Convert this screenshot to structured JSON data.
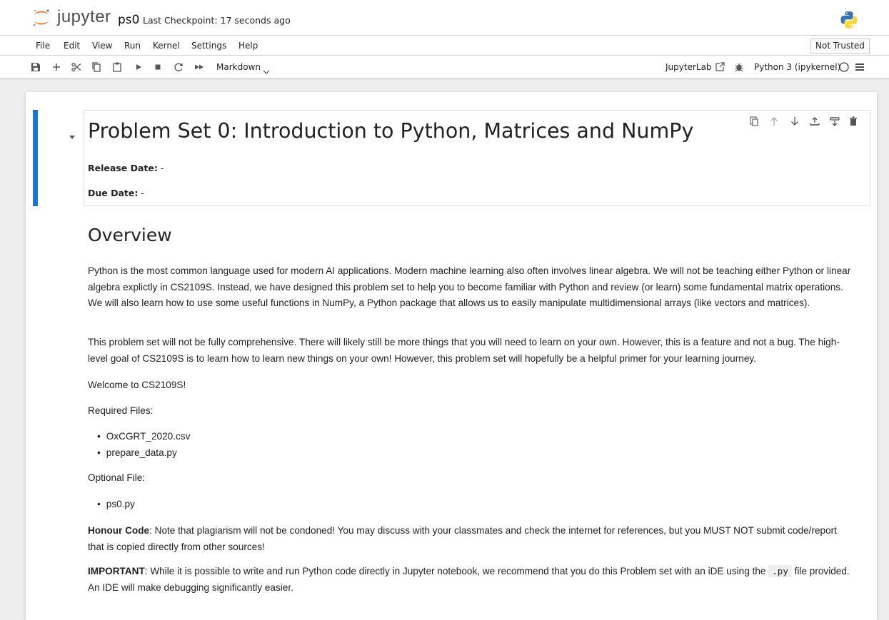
{
  "app": {
    "logo_text": "jupyter",
    "notebook_name": "ps0",
    "checkpoint": "Last Checkpoint: 17 seconds ago"
  },
  "menu": {
    "items": [
      "File",
      "Edit",
      "View",
      "Run",
      "Kernel",
      "Settings",
      "Help"
    ],
    "trusted": "Not Trusted"
  },
  "toolbar": {
    "icons": [
      "save-icon",
      "add-icon",
      "cut-icon",
      "copy-icon",
      "paste-icon",
      "run-icon",
      "stop-icon",
      "restart-icon",
      "fast-forward-icon"
    ],
    "cell_type": "Markdown",
    "jupyterlab": "JupyterLab",
    "kernel": "Python 3 (ipykernel)"
  },
  "cell_tools": [
    "duplicate-icon",
    "move-up-icon",
    "move-down-icon",
    "insert-above-icon",
    "insert-below-icon",
    "delete-icon"
  ],
  "content": {
    "title": "Problem Set 0: Introduction to Python, Matrices and NumPy",
    "release_label": "Release Date:",
    "release_value": " -",
    "due_label": "Due Date:",
    "due_value": " -",
    "overview_heading": "Overview",
    "para1": "Python is the most common language used for modern AI applications. Modern machine learning also often involves linear algebra. We will not be teaching either Python or linear algebra explictly in CS2109S. Instead, we have designed this problem set to help you to become familiar with Python and review (or learn) some fundamental matrix operations. We will also learn how to use some useful functions in NumPy, a Python package that allows us to easily manipulate multidimensional arrays (like vectors and matrices).",
    "para2": "This problem set will not be fully comprehensive. There will likely still be more things that you will need to learn on your own. However, this is a feature and not a bug. The high-level goal of CS2109S is to learn how to learn new things on your own! However, this problem set will hopefully be a helpful primer for your learning journey.",
    "welcome": "Welcome to CS2109S!",
    "required_label": "Required Files:",
    "required_files": [
      "OxCGRT_2020.csv",
      "prepare_data.py"
    ],
    "optional_label": "Optional File:",
    "optional_files": [
      "ps0.py"
    ],
    "honour_label": "Honour Code",
    "honour_text": ": Note that plagiarism will not be condoned! You may discuss with your classmates and check the internet for references, but you MUST NOT submit code/report that is copied directly from other sources!",
    "important_label": "IMPORTANT",
    "important_text1": ": While it is possible to write and run Python code directly in Jupyter notebook, we recommend that you do this Problem set with an iDE using the ",
    "important_code": ".py",
    "important_text2": " file provided. An IDE will make debugging significantly easier."
  },
  "colors": {
    "active_cell_bar": "#1976d2",
    "logo_orange": "#f37726"
  }
}
